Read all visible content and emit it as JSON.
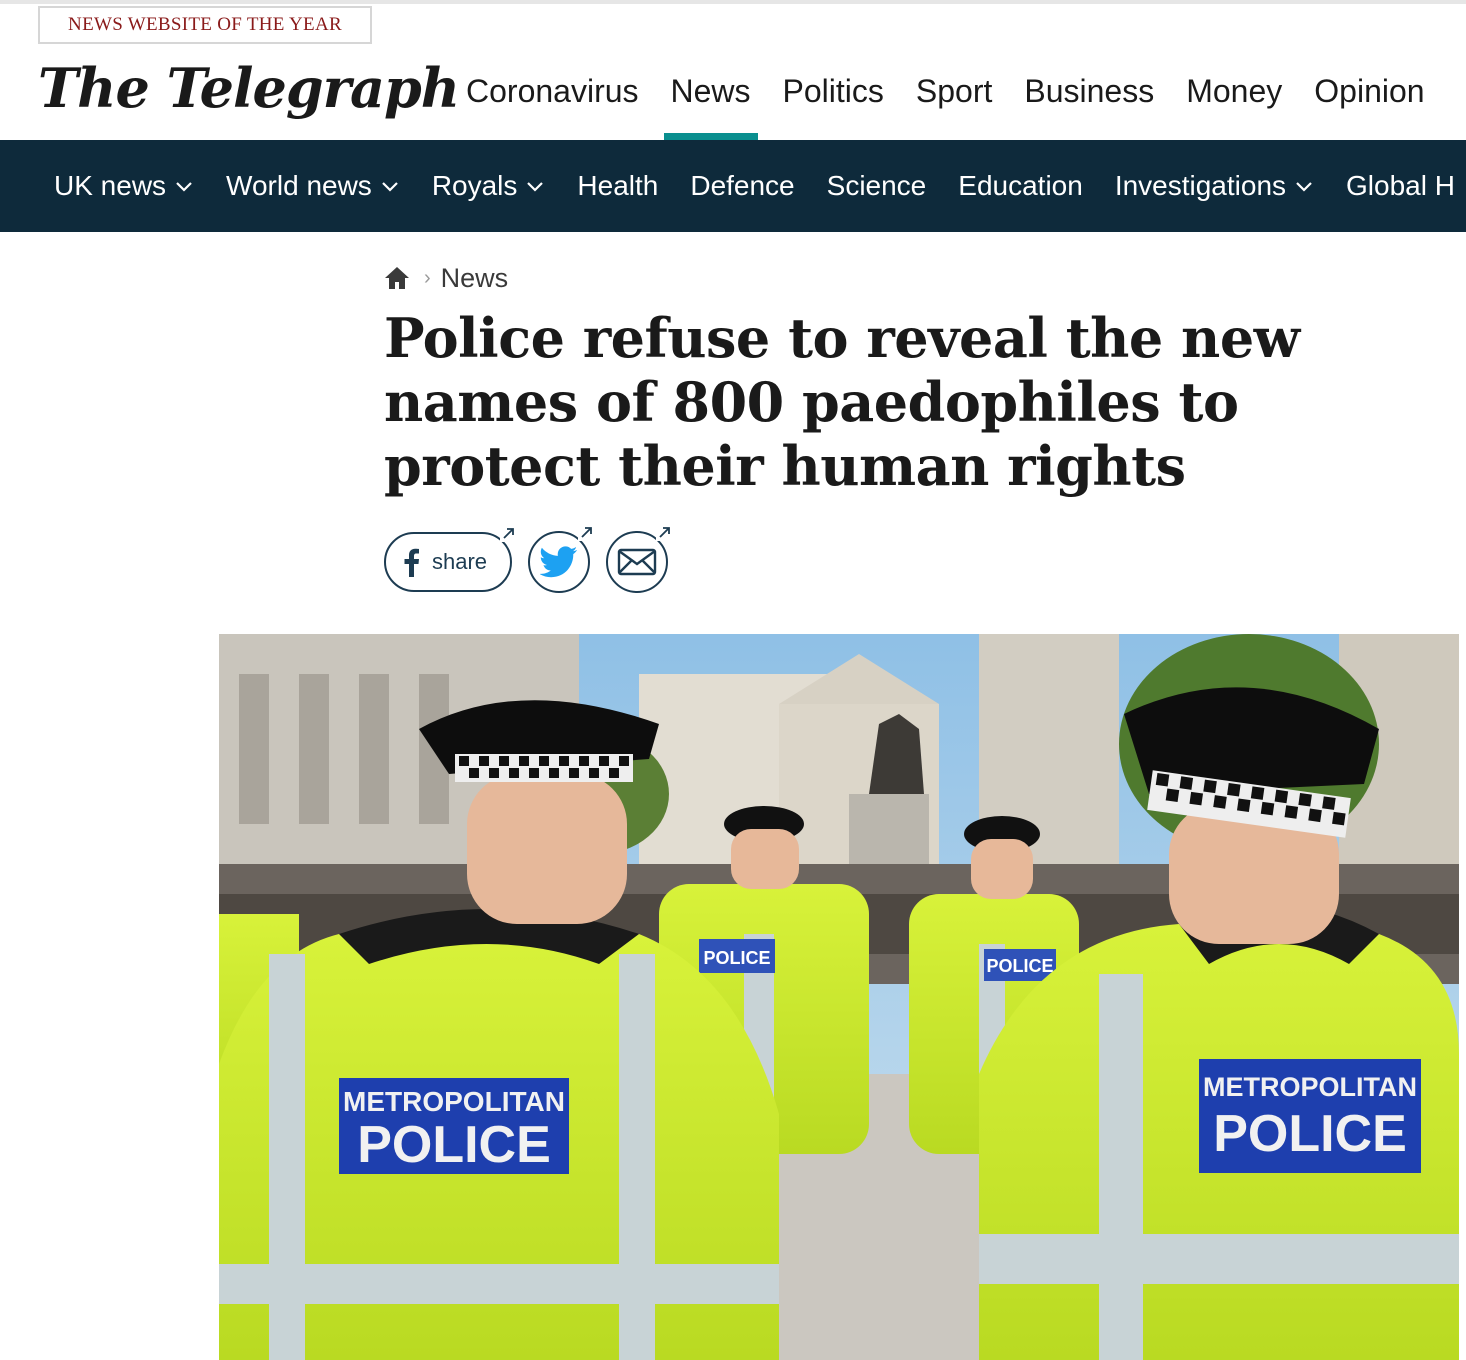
{
  "award_badge": "NEWS WEBSITE OF THE YEAR",
  "logo_text": "The Telegraph",
  "primary_nav": [
    {
      "label": "Coronavirus",
      "active": false
    },
    {
      "label": "News",
      "active": true
    },
    {
      "label": "Politics",
      "active": false
    },
    {
      "label": "Sport",
      "active": false
    },
    {
      "label": "Business",
      "active": false
    },
    {
      "label": "Money",
      "active": false
    },
    {
      "label": "Opinion",
      "active": false
    }
  ],
  "secondary_nav": [
    {
      "label": "UK news",
      "dropdown": true
    },
    {
      "label": "World news",
      "dropdown": true
    },
    {
      "label": "Royals",
      "dropdown": true
    },
    {
      "label": "Health",
      "dropdown": false
    },
    {
      "label": "Defence",
      "dropdown": false
    },
    {
      "label": "Science",
      "dropdown": false
    },
    {
      "label": "Education",
      "dropdown": false
    },
    {
      "label": "Investigations",
      "dropdown": true
    },
    {
      "label": "Global H",
      "dropdown": false
    }
  ],
  "breadcrumb": {
    "section": "News"
  },
  "article": {
    "headline": "Police refuse to reveal the new names of 800 paedophiles to protect their human rights"
  },
  "share": {
    "facebook_label": "share"
  },
  "hero_image": {
    "badge_left_line1": "METROPOLITAN",
    "badge_left_line2": "POLICE",
    "badge_right_line1": "METROPOLITAN",
    "badge_right_line2": "POLICE",
    "badge_mid1": "POLICE",
    "badge_mid2": "POLICE"
  },
  "colors": {
    "brand_teal": "#0a8f8f",
    "nav_dark": "#0e2a3b",
    "award_red": "#8a1a1a",
    "twitter_blue": "#1da1f2",
    "facebook_navy": "#1d3c52"
  }
}
